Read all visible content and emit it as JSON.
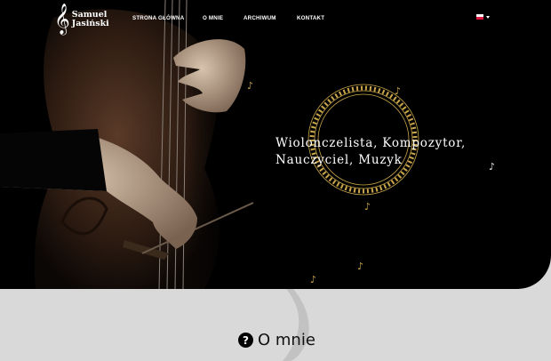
{
  "brand": {
    "line1": "Samuel",
    "line2": "Jasiński",
    "clef": "𝄞"
  },
  "nav": {
    "items": [
      {
        "label": "STRONA GŁÓWNA"
      },
      {
        "label": "O MNIE"
      },
      {
        "label": "ARCHIWUM"
      },
      {
        "label": "KONTAKT"
      }
    ]
  },
  "lang": {
    "current": "pl"
  },
  "hero": {
    "line1": "Wiolonczelista, Kompozytor,",
    "line2": "Nauczyciel, Muzyk"
  },
  "about": {
    "icon": "?",
    "title": "O mnie"
  },
  "colors": {
    "hero_bg": "#000000",
    "section_bg": "#d9d9d9",
    "accent_gold": "#c9a64a"
  }
}
